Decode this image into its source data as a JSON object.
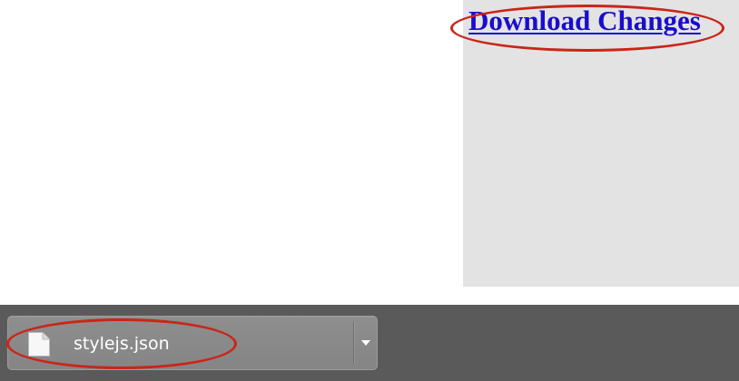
{
  "page": {
    "download_link_label": "Download Changes"
  },
  "downloads_shelf": {
    "item": {
      "file_name": "stylejs.json",
      "file_icon": "document-icon",
      "menu_icon": "chevron-down-icon"
    }
  },
  "colors": {
    "link": "#1a0dcc",
    "side_panel": "#e3e3e3",
    "shelf_background": "#5a5a5a",
    "item_background": "#8a8a8a",
    "highlight": "#cc2418"
  }
}
